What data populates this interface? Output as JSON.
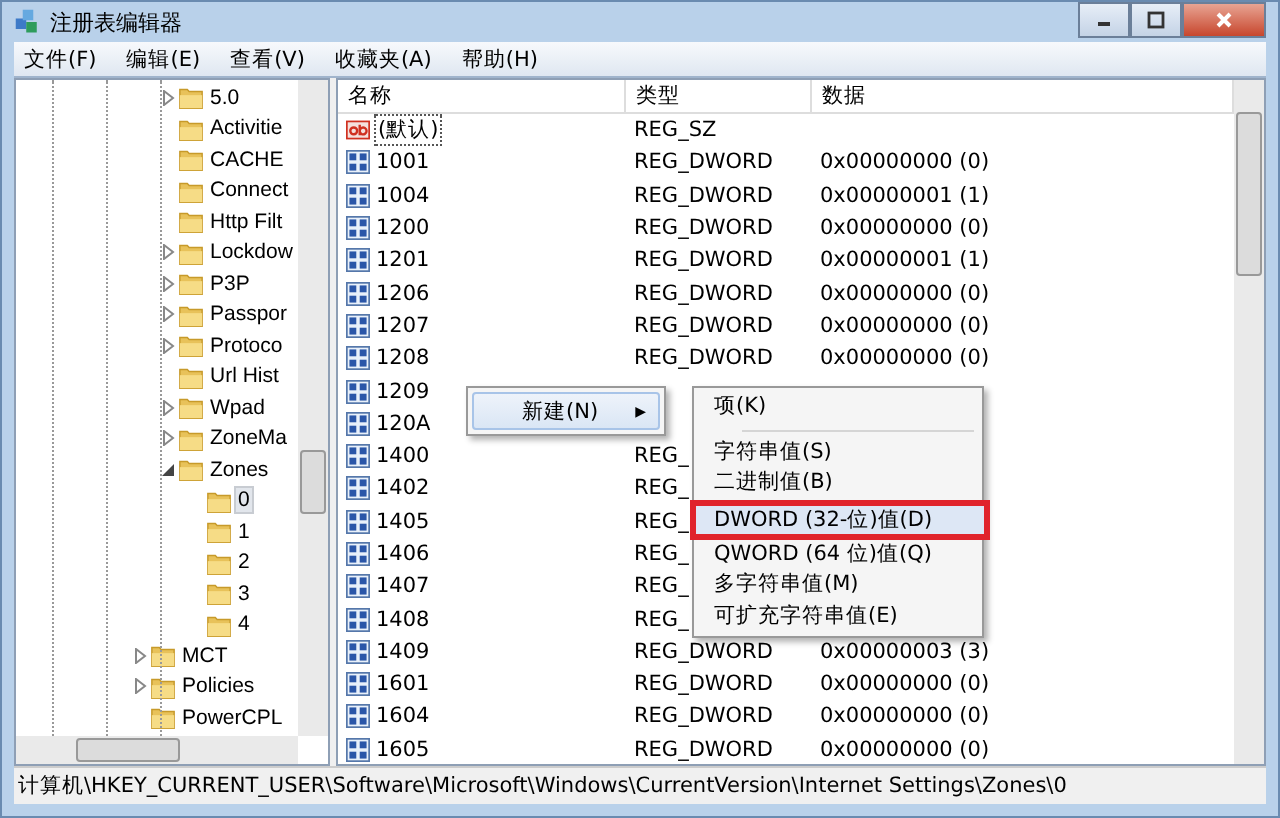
{
  "window": {
    "title": "注册表编辑器"
  },
  "menu_bar": [
    "文件(F)",
    "编辑(E)",
    "查看(V)",
    "收藏夹(A)",
    "帮助(H)"
  ],
  "tree": {
    "items": [
      {
        "children": [
          {
            "label": "5.0",
            "expandable": true,
            "expanded": false,
            "selected": false
          },
          {
            "label": "Activitie",
            "expandable": false,
            "selected": false
          },
          {
            "label": "CACHE",
            "expandable": false,
            "selected": false
          },
          {
            "label": "Connect",
            "expandable": false,
            "selected": false
          },
          {
            "label": "Http Filt",
            "expandable": false,
            "selected": false
          },
          {
            "label": "Lockdow",
            "expandable": true,
            "expanded": false,
            "selected": false
          },
          {
            "label": "P3P",
            "expandable": true,
            "expanded": false,
            "selected": false
          },
          {
            "label": "Passpor",
            "expandable": true,
            "expanded": false,
            "selected": false
          },
          {
            "label": "Protoco",
            "expandable": true,
            "expanded": false,
            "selected": false
          },
          {
            "label": "Url Hist",
            "expandable": false,
            "selected": false
          },
          {
            "label": "Wpad",
            "expandable": true,
            "expanded": false,
            "selected": false
          },
          {
            "label": "ZoneMa",
            "expandable": true,
            "expanded": false,
            "selected": false
          },
          {
            "label": "Zones",
            "expandable": true,
            "expanded": true,
            "selected": false,
            "children": [
              {
                "label": "0",
                "expandable": false,
                "selected": true
              },
              {
                "label": "1",
                "expandable": false,
                "selected": false
              },
              {
                "label": "2",
                "expandable": false,
                "selected": false
              },
              {
                "label": "3",
                "expandable": false,
                "selected": false
              },
              {
                "label": "4",
                "expandable": false,
                "selected": false
              }
            ]
          }
        ]
      },
      {
        "label": "MCT",
        "expandable": true,
        "expanded": false,
        "selected": false
      },
      {
        "label": "Policies",
        "expandable": true,
        "expanded": false,
        "selected": false
      },
      {
        "label": "PowerCPL",
        "expandable": false,
        "selected": false
      }
    ]
  },
  "list": {
    "columns": [
      "名称",
      "类型",
      "数据"
    ],
    "rows": [
      {
        "kind": "string",
        "name": "(默认)",
        "type": "REG_SZ",
        "data": ""
      },
      {
        "kind": "dword",
        "name": "1001",
        "type": "REG_DWORD",
        "data": "0x00000000 (0)"
      },
      {
        "kind": "dword",
        "name": "1004",
        "type": "REG_DWORD",
        "data": "0x00000001 (1)"
      },
      {
        "kind": "dword",
        "name": "1200",
        "type": "REG_DWORD",
        "data": "0x00000000 (0)"
      },
      {
        "kind": "dword",
        "name": "1201",
        "type": "REG_DWORD",
        "data": "0x00000001 (1)"
      },
      {
        "kind": "dword",
        "name": "1206",
        "type": "REG_DWORD",
        "data": "0x00000000 (0)"
      },
      {
        "kind": "dword",
        "name": "1207",
        "type": "REG_DWORD",
        "data": "0x00000000 (0)"
      },
      {
        "kind": "dword",
        "name": "1208",
        "type": "REG_DWORD",
        "data": "0x00000000 (0)"
      },
      {
        "kind": "dword",
        "name": "1209",
        "type": "",
        "data": ""
      },
      {
        "kind": "dword",
        "name": "120A",
        "type": "",
        "data": ""
      },
      {
        "kind": "dword",
        "name": "1400",
        "type": "REG_",
        "data": ""
      },
      {
        "kind": "dword",
        "name": "1402",
        "type": "REG_",
        "data": ""
      },
      {
        "kind": "dword",
        "name": "1405",
        "type": "REG_",
        "data": ""
      },
      {
        "kind": "dword",
        "name": "1406",
        "type": "REG_",
        "data": ""
      },
      {
        "kind": "dword",
        "name": "1407",
        "type": "REG_",
        "data": ""
      },
      {
        "kind": "dword",
        "name": "1408",
        "type": "REG_",
        "data": ""
      },
      {
        "kind": "dword",
        "name": "1409",
        "type": "REG_DWORD",
        "data": "0x00000003 (3)"
      },
      {
        "kind": "dword",
        "name": "1601",
        "type": "REG_DWORD",
        "data": "0x00000000 (0)"
      },
      {
        "kind": "dword",
        "name": "1604",
        "type": "REG_DWORD",
        "data": "0x00000000 (0)"
      },
      {
        "kind": "dword",
        "name": "1605",
        "type": "REG_DWORD",
        "data": "0x00000000 (0)"
      }
    ]
  },
  "context_menu": {
    "label": "新建(N)",
    "arrow": "▶",
    "selected": true
  },
  "submenu": {
    "items": [
      {
        "label": "项(K)",
        "highlighted": false
      },
      {
        "kind": "separator"
      },
      {
        "label": "字符串值(S)",
        "highlighted": false
      },
      {
        "label": "二进制值(B)",
        "highlighted": false
      },
      {
        "label": "DWORD (32-位)值(D)",
        "highlighted": true
      },
      {
        "label": "QWORD (64 位)值(Q)",
        "highlighted": false
      },
      {
        "label": "多字符串值(M)",
        "highlighted": false
      },
      {
        "label": "可扩充字符串值(E)",
        "highlighted": false
      }
    ]
  },
  "status_bar": "计算机\\HKEY_CURRENT_USER\\Software\\Microsoft\\Windows\\CurrentVersion\\Internet Settings\\Zones\\0"
}
